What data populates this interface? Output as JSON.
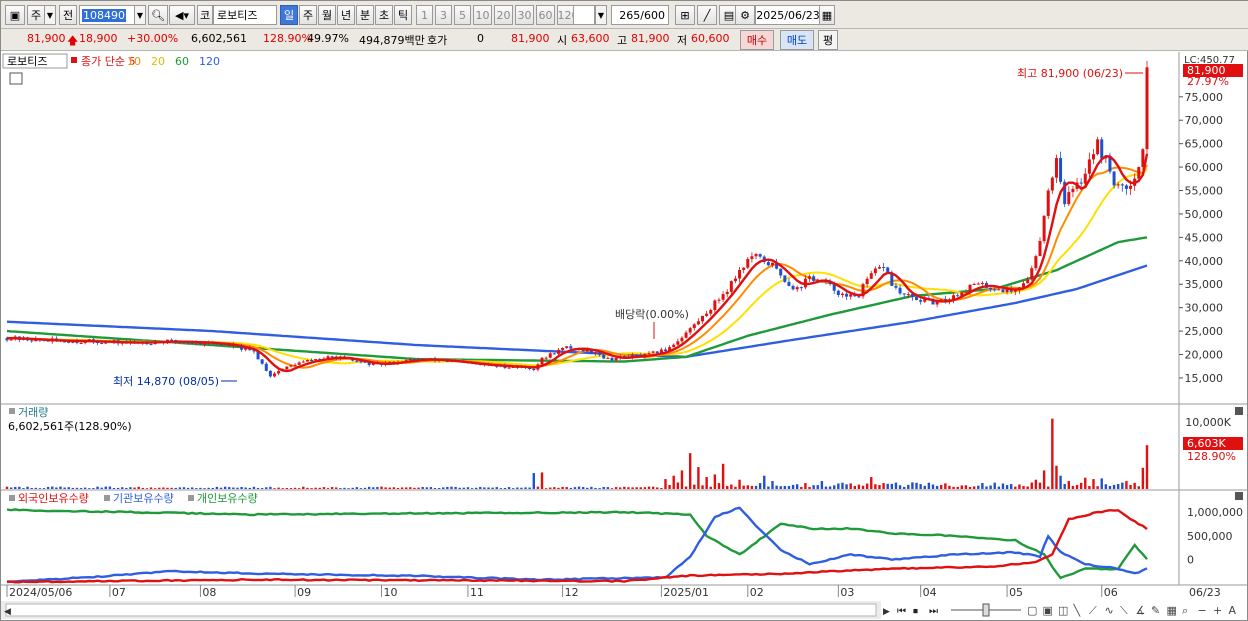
{
  "toolbar": {
    "market": "주",
    "prev_label": "전",
    "code": "108490",
    "search_icon": "search-icon",
    "sound_icon": "speaker-icon",
    "stock_prefix": "코",
    "stock_name": "로보티즈",
    "periods": [
      "일",
      "주",
      "월",
      "년",
      "분",
      "초",
      "틱"
    ],
    "active_period": "일",
    "intervals": [
      "1",
      "3",
      "5",
      "10",
      "20",
      "30",
      "60",
      "120"
    ],
    "count": "265",
    "count_total": "/600",
    "date": "2025/06/23",
    "calendar_icon": "calendar-icon"
  },
  "quote": {
    "price": "81,900",
    "change": "18,900",
    "change_pct": "+30.00%",
    "volume": "6,602,561",
    "vol_ratio": "128.90%",
    "turnover": "49.97%",
    "amount": "494,879백만",
    "hoga_label": "호가",
    "hoga_value": "0",
    "cur": "81,900",
    "open_label": "시",
    "open": "63,600",
    "high_label": "고",
    "high": "81,900",
    "low_label": "저",
    "low": "60,600",
    "buy": "매수",
    "sell": "매도",
    "eval": "평"
  },
  "chart_data": [
    {
      "type": "candlestick",
      "title": "로보티즈",
      "legend": [
        "종가 단순 5",
        "10",
        "20",
        "60",
        "120"
      ],
      "colors": {
        "ma5": "#e01010",
        "ma10": "#ff8c00",
        "ma20": "#ffe000",
        "ma60": "#1f9a3a",
        "ma120": "#2f5fe0",
        "up": "#e01010",
        "down": "#1f4fd0"
      },
      "x_ticks": [
        "2024/05/06",
        "07",
        "08",
        "09",
        "10",
        "11",
        "12",
        "2025/01",
        "02",
        "03",
        "04",
        "05",
        "06",
        "06/23"
      ],
      "y_ticks": [
        "75,000",
        "70,000",
        "65,000",
        "60,000",
        "55,000",
        "50,000",
        "45,000",
        "40,000",
        "35,000",
        "30,000",
        "25,000",
        "20,000",
        "15,000"
      ],
      "ylim": [
        12000,
        82000
      ],
      "top_label": "LC:450.77",
      "last_price_tag": "81,900",
      "last_pct_tag": "27.97%",
      "annotations": {
        "high": "최고 81,900 (06/23)",
        "low": "최저 14,870 (08/05)",
        "dividend": "배당락(0.00%)"
      },
      "close": [
        [
          0,
          23500
        ],
        [
          10,
          23000
        ],
        [
          20,
          22800
        ],
        [
          30,
          22500
        ],
        [
          40,
          22800
        ],
        [
          50,
          22400
        ],
        [
          55,
          21800
        ],
        [
          60,
          20500
        ],
        [
          62,
          18000
        ],
        [
          64,
          15500
        ],
        [
          66,
          16500
        ],
        [
          70,
          18000
        ],
        [
          75,
          19000
        ],
        [
          80,
          19500
        ],
        [
          85,
          18500
        ],
        [
          90,
          17800
        ],
        [
          95,
          18500
        ],
        [
          100,
          19000
        ],
        [
          105,
          18800
        ],
        [
          110,
          18300
        ],
        [
          115,
          17800
        ],
        [
          120,
          17500
        ],
        [
          125,
          17300
        ],
        [
          128,
          17000
        ],
        [
          130,
          19000
        ],
        [
          133,
          20500
        ],
        [
          136,
          21500
        ],
        [
          140,
          21000
        ],
        [
          143,
          20500
        ],
        [
          146,
          19000
        ],
        [
          150,
          19500
        ],
        [
          155,
          19800
        ],
        [
          160,
          21000
        ],
        [
          163,
          23000
        ],
        [
          166,
          25500
        ],
        [
          169,
          28000
        ],
        [
          172,
          31000
        ],
        [
          175,
          34000
        ],
        [
          178,
          38000
        ],
        [
          181,
          41000
        ],
        [
          184,
          40000
        ],
        [
          186,
          39000
        ],
        [
          188,
          37000
        ],
        [
          190,
          35000
        ],
        [
          192,
          34000
        ],
        [
          195,
          36500
        ],
        [
          198,
          35500
        ],
        [
          201,
          34000
        ],
        [
          204,
          32000
        ],
        [
          207,
          33000
        ],
        [
          210,
          37000
        ],
        [
          213,
          39000
        ],
        [
          215,
          35000
        ],
        [
          217,
          33000
        ],
        [
          220,
          32000
        ],
        [
          223,
          31500
        ],
        [
          226,
          31000
        ],
        [
          229,
          32000
        ],
        [
          232,
          33500
        ],
        [
          235,
          35000
        ],
        [
          238,
          34500
        ],
        [
          241,
          34000
        ],
        [
          244,
          33500
        ],
        [
          247,
          35000
        ],
        [
          249,
          38000
        ],
        [
          251,
          45000
        ],
        [
          253,
          55000
        ],
        [
          255,
          62000
        ],
        [
          257,
          53000
        ],
        [
          259,
          55000
        ],
        [
          261,
          57000
        ],
        [
          263,
          62000
        ],
        [
          265,
          65000
        ],
        [
          267,
          61000
        ],
        [
          269,
          57000
        ],
        [
          271,
          55000
        ],
        [
          273,
          57000
        ],
        [
          275,
          60000
        ],
        [
          276,
          63500
        ],
        [
          277,
          81900
        ]
      ],
      "ma60": [
        [
          0,
          25000
        ],
        [
          50,
          22000
        ],
        [
          100,
          19000
        ],
        [
          150,
          18500
        ],
        [
          165,
          19500
        ],
        [
          180,
          24000
        ],
        [
          200,
          28500
        ],
        [
          220,
          32500
        ],
        [
          240,
          34000
        ],
        [
          255,
          38000
        ],
        [
          270,
          44000
        ],
        [
          277,
          45000
        ]
      ],
      "ma120": [
        [
          0,
          27000
        ],
        [
          50,
          25000
        ],
        [
          100,
          22000
        ],
        [
          150,
          20000
        ],
        [
          165,
          19500
        ],
        [
          190,
          23000
        ],
        [
          220,
          27000
        ],
        [
          245,
          31000
        ],
        [
          260,
          34000
        ],
        [
          277,
          39000
        ]
      ]
    },
    {
      "type": "bar",
      "title": "거래량",
      "subtitle": "6,602,561주(128.90%)",
      "y_ticks": [
        "10,000K"
      ],
      "last_tag": "6,603K",
      "last_pct_tag": "128.90%",
      "ylim": [
        0,
        11000
      ],
      "spikes": [
        [
          128,
          2400
        ],
        [
          130,
          2500
        ],
        [
          160,
          1500
        ],
        [
          162,
          2000
        ],
        [
          164,
          2800
        ],
        [
          166,
          5400
        ],
        [
          168,
          3300
        ],
        [
          170,
          1800
        ],
        [
          172,
          2200
        ],
        [
          174,
          3800
        ],
        [
          178,
          1400
        ],
        [
          184,
          2000
        ],
        [
          186,
          1200
        ],
        [
          198,
          1200
        ],
        [
          210,
          1800
        ],
        [
          220,
          1000
        ],
        [
          250,
          1400
        ],
        [
          252,
          2800
        ],
        [
          254,
          10600
        ],
        [
          255,
          3500
        ],
        [
          256,
          2000
        ],
        [
          258,
          1200
        ],
        [
          262,
          1700
        ],
        [
          264,
          1500
        ],
        [
          266,
          1600
        ],
        [
          272,
          1200
        ],
        [
          276,
          3200
        ],
        [
          277,
          6603
        ]
      ]
    },
    {
      "type": "line",
      "title": "외국인보유수량",
      "legend": [
        "외국인보유수량",
        "기관보유수량",
        "개인보유수량"
      ],
      "colors": {
        "foreign": "#e01010",
        "inst": "#2f5fe0",
        "indiv": "#1f9a3a"
      },
      "y_ticks": [
        "1,000,000",
        "500,000",
        "0"
      ],
      "ylim": [
        -500000,
        1300000
      ],
      "foreign": [
        [
          0,
          -480000
        ],
        [
          60,
          -430000
        ],
        [
          150,
          -460000
        ],
        [
          166,
          -340000
        ],
        [
          180,
          -320000
        ],
        [
          190,
          -300000
        ],
        [
          200,
          -250000
        ],
        [
          215,
          -200000
        ],
        [
          240,
          -150000
        ],
        [
          250,
          -50000
        ],
        [
          254,
          100000
        ],
        [
          258,
          850000
        ],
        [
          265,
          1000000
        ],
        [
          270,
          1050000
        ],
        [
          274,
          800000
        ],
        [
          277,
          650000
        ]
      ],
      "inst": [
        [
          0,
          -480000
        ],
        [
          25,
          -350000
        ],
        [
          40,
          -250000
        ],
        [
          60,
          -300000
        ],
        [
          100,
          -350000
        ],
        [
          130,
          -430000
        ],
        [
          160,
          -380000
        ],
        [
          166,
          50000
        ],
        [
          172,
          900000
        ],
        [
          178,
          1100000
        ],
        [
          182,
          700000
        ],
        [
          188,
          200000
        ],
        [
          195,
          -100000
        ],
        [
          205,
          100000
        ],
        [
          215,
          0
        ],
        [
          230,
          100000
        ],
        [
          245,
          150000
        ],
        [
          251,
          60000
        ],
        [
          253,
          500000
        ],
        [
          256,
          150000
        ],
        [
          262,
          -100000
        ],
        [
          270,
          -200000
        ],
        [
          274,
          -300000
        ],
        [
          277,
          -200000
        ]
      ],
      "indiv": [
        [
          0,
          1050000
        ],
        [
          60,
          950000
        ],
        [
          150,
          1000000
        ],
        [
          166,
          950000
        ],
        [
          170,
          500000
        ],
        [
          178,
          100000
        ],
        [
          188,
          750000
        ],
        [
          196,
          650000
        ],
        [
          206,
          650000
        ],
        [
          215,
          550000
        ],
        [
          230,
          500000
        ],
        [
          245,
          400000
        ],
        [
          252,
          100000
        ],
        [
          256,
          -400000
        ],
        [
          262,
          -200000
        ],
        [
          270,
          -200000
        ],
        [
          274,
          300000
        ],
        [
          277,
          0
        ]
      ]
    }
  ]
}
